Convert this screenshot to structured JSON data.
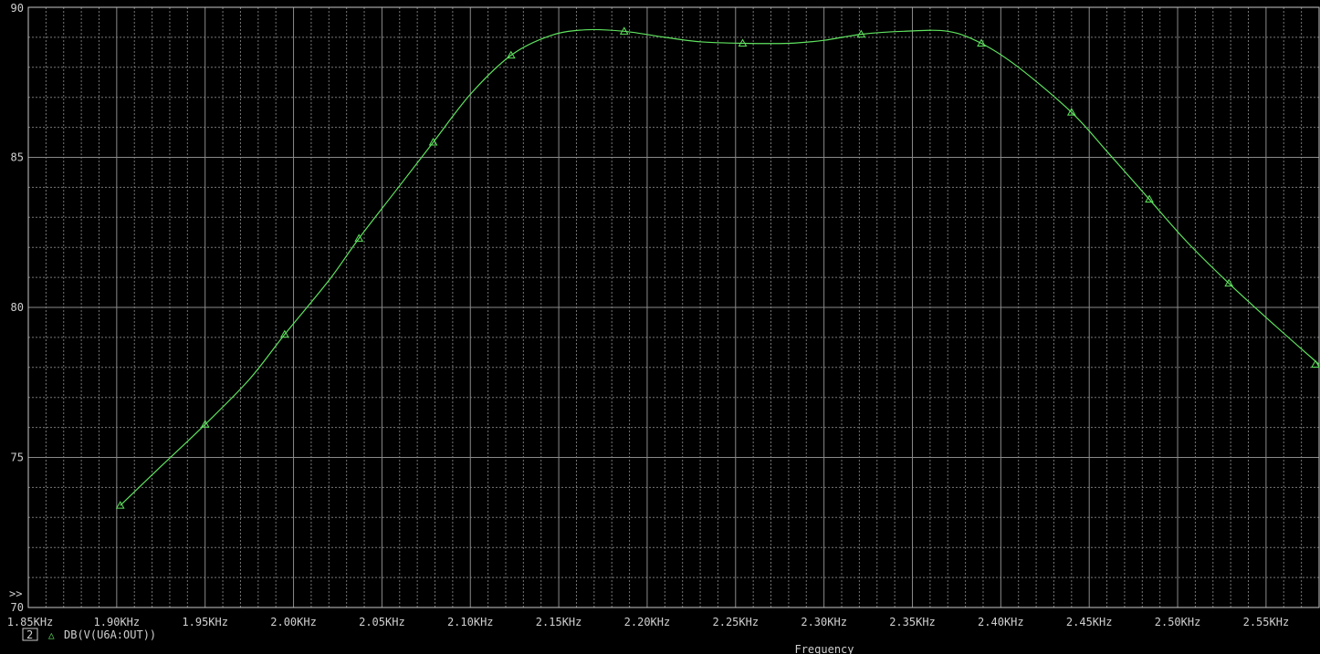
{
  "chart_data": {
    "type": "line",
    "xlabel": "Frequency",
    "x_range": [
      1.85,
      2.58
    ],
    "ylim": [
      70,
      90
    ],
    "x_ticks": [
      "1.85KHz",
      "1.90KHz",
      "1.95KHz",
      "2.00KHz",
      "2.05KHz",
      "2.10KHz",
      "2.15KHz",
      "2.20KHz",
      "2.25KHz",
      "2.30KHz",
      "2.35KHz",
      "2.40KHz",
      "2.45KHz",
      "2.50KHz",
      "2.55KHz"
    ],
    "y_ticks": [
      "70",
      "75",
      "80",
      "85",
      "90"
    ],
    "grid": true,
    "series": [
      {
        "name": "DB(V(U6A:OUT))",
        "color": "#5fe35f",
        "x": [
          1.902,
          1.925,
          1.95,
          1.975,
          1.995,
          2.02,
          2.037,
          2.058,
          2.079,
          2.1,
          2.123,
          2.145,
          2.165,
          2.187,
          2.21,
          2.23,
          2.254,
          2.28,
          2.3,
          2.321,
          2.345,
          2.37,
          2.389,
          2.41,
          2.44,
          2.46,
          2.484,
          2.505,
          2.529,
          2.555,
          2.58
        ],
        "y": [
          73.4,
          74.7,
          76.1,
          77.6,
          79.1,
          80.9,
          82.3,
          83.9,
          85.5,
          87.1,
          88.4,
          89.05,
          89.25,
          89.2,
          89.0,
          88.85,
          88.8,
          88.8,
          88.9,
          89.1,
          89.2,
          89.2,
          88.8,
          88.0,
          86.5,
          85.2,
          83.6,
          82.2,
          80.8,
          79.4,
          78.1
        ]
      }
    ],
    "markers": {
      "x": [
        1.902,
        1.95,
        1.995,
        2.037,
        2.079,
        2.123,
        2.187,
        2.254,
        2.321,
        2.389,
        2.44,
        2.484,
        2.529,
        2.58
      ],
      "y": [
        73.4,
        76.1,
        79.1,
        82.3,
        85.5,
        88.4,
        89.2,
        88.8,
        89.1,
        88.8,
        86.5,
        83.6,
        80.8,
        78.1
      ]
    }
  },
  "legend": {
    "number": "2",
    "marker_glyph": "△",
    "label": "DB(V(U6A:OUT))"
  },
  "overflow_indicator": ">>",
  "colors": {
    "background": "#000000",
    "grid_major": "#8a8a8a",
    "grid_minor": "#777777",
    "frame": "#c8c8c8",
    "text": "#d0d0d0",
    "trace": "#5fe35f"
  }
}
